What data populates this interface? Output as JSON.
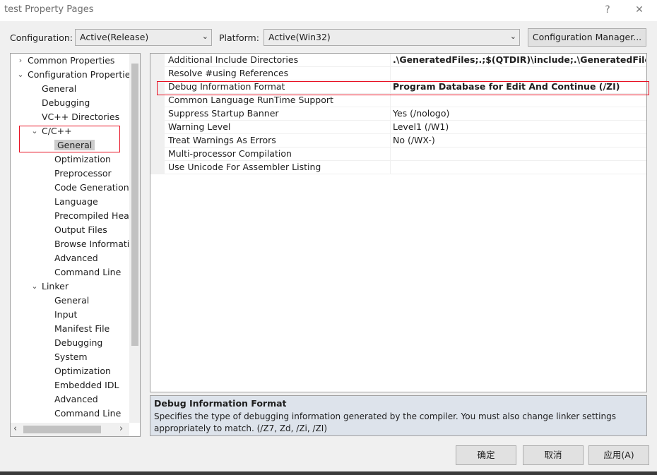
{
  "window": {
    "title": "test Property Pages",
    "help_glyph": "?",
    "close_glyph": "✕"
  },
  "config_bar": {
    "configuration_label": "Configuration:",
    "configuration_value": "Active(Release)",
    "platform_label": "Platform:",
    "platform_value": "Active(Win32)",
    "manager_button": "Configuration Manager..."
  },
  "tree": {
    "items": [
      {
        "label": "Common Properties",
        "expander": "›"
      },
      {
        "label": "Configuration Properties",
        "expander": "⌄"
      },
      {
        "label": "General"
      },
      {
        "label": "Debugging"
      },
      {
        "label": "VC++ Directories"
      },
      {
        "label": "C/C++",
        "expander": "⌄"
      },
      {
        "label": "General",
        "selected": true
      },
      {
        "label": "Optimization"
      },
      {
        "label": "Preprocessor"
      },
      {
        "label": "Code Generation"
      },
      {
        "label": "Language"
      },
      {
        "label": "Precompiled Head"
      },
      {
        "label": "Output Files"
      },
      {
        "label": "Browse Informatic"
      },
      {
        "label": "Advanced"
      },
      {
        "label": "Command Line"
      },
      {
        "label": "Linker",
        "expander": "⌄"
      },
      {
        "label": "General"
      },
      {
        "label": "Input"
      },
      {
        "label": "Manifest File"
      },
      {
        "label": "Debugging"
      },
      {
        "label": "System"
      },
      {
        "label": "Optimization"
      },
      {
        "label": "Embedded IDL"
      },
      {
        "label": "Advanced"
      },
      {
        "label": "Command Line"
      }
    ],
    "scroll_left_glyph": "‹",
    "scroll_right_glyph": "›"
  },
  "properties": {
    "rows": [
      {
        "name": "Additional Include Directories",
        "value": ".\\GeneratedFiles;.;$(QTDIR)\\include;.\\GeneratedFiles\\$(Cor",
        "bold": true
      },
      {
        "name": "Resolve #using References",
        "value": ""
      },
      {
        "name": "Debug Information Format",
        "value": "Program Database for Edit And Continue (/ZI)",
        "bold": true
      },
      {
        "name": "Common Language RunTime Support",
        "value": ""
      },
      {
        "name": "Suppress Startup Banner",
        "value": "Yes (/nologo)"
      },
      {
        "name": "Warning Level",
        "value": "Level1 (/W1)"
      },
      {
        "name": "Treat Warnings As Errors",
        "value": "No (/WX-)"
      },
      {
        "name": "Multi-processor Compilation",
        "value": ""
      },
      {
        "name": "Use Unicode For Assembler Listing",
        "value": ""
      }
    ]
  },
  "description": {
    "title": "Debug Information Format",
    "text": "Specifies the type of debugging information generated by the compiler.  You must also change linker settings appropriately to match.    (/Z7, Zd, /Zi, /ZI)"
  },
  "buttons": {
    "ok": "确定",
    "cancel": "取消",
    "apply": "应用(A)"
  },
  "colors": {
    "highlight_border": "#e81123",
    "description_bg": "#dde3eb",
    "selection_bg": "#cccccc"
  }
}
